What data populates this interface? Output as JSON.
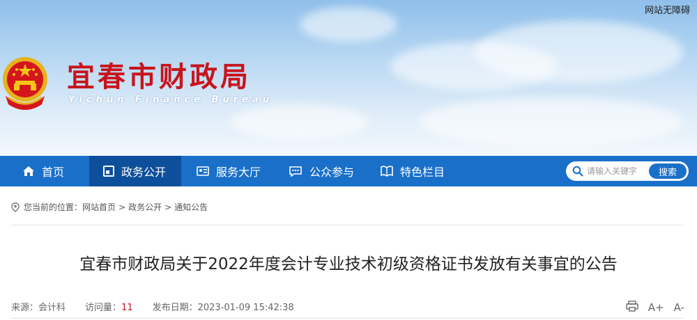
{
  "accessibility_link": "网站无障碍",
  "site": {
    "title": "宜春市财政局",
    "subtitle": "Yichun Finance Bureau"
  },
  "nav": {
    "items": [
      {
        "label": "首页",
        "icon": "home-icon"
      },
      {
        "label": "政务公开",
        "icon": "document-icon",
        "active": true
      },
      {
        "label": "服务大厅",
        "icon": "id-card-icon"
      },
      {
        "label": "公众参与",
        "icon": "chat-bubble-icon"
      },
      {
        "label": "特色栏目",
        "icon": "book-icon"
      }
    ]
  },
  "search": {
    "placeholder": "请输入关键字",
    "button": "搜索"
  },
  "breadcrumb": {
    "prefix": "您当前的位置：",
    "items": [
      "网站首页",
      "政务公开",
      "通知公告"
    ],
    "separator": ">"
  },
  "article": {
    "title": "宜春市财政局关于2022年度会计专业技术初级资格证书发放有关事宜的公告",
    "source_label": "来源：",
    "source": "会计科",
    "hits_label": "访问量：",
    "hits": "11",
    "date_label": "发布日期：",
    "date": "2023-01-09 15:42:38"
  },
  "tools": {
    "print": "print-icon",
    "font_increase": "A+",
    "font_decrease": "A-"
  },
  "colors": {
    "nav_bg": "#1a6fc9",
    "nav_active": "#0d4f9a",
    "title_red": "#c8141c"
  }
}
